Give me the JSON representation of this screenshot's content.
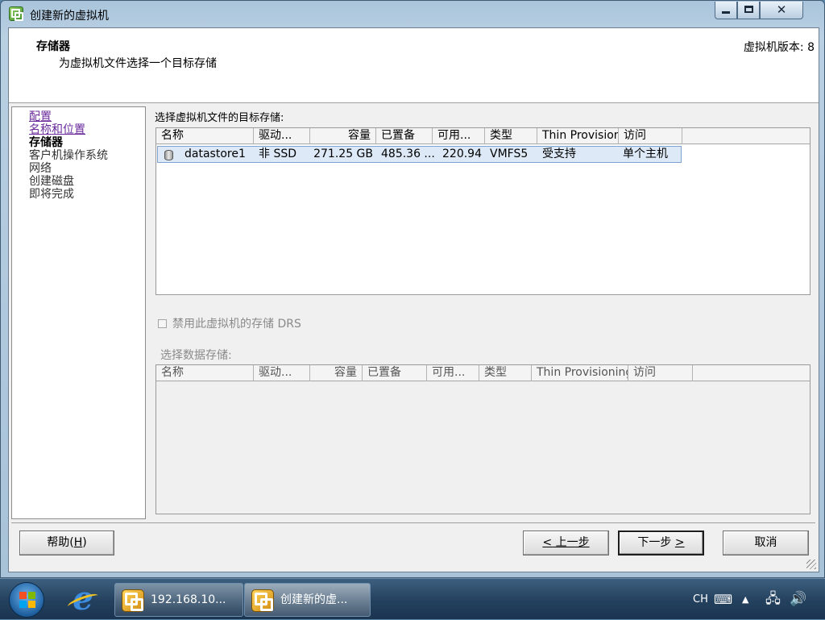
{
  "window": {
    "title": "创建新的虚拟机",
    "controls": {
      "minimize": "minimize-icon",
      "maximize": "maximize-icon",
      "close": "close-icon"
    }
  },
  "header": {
    "title": "存储器",
    "subtitle": "为虚拟机文件选择一个目标存储",
    "version": "虚拟机版本: 8"
  },
  "nav": {
    "items": [
      {
        "label": "配置",
        "state": "visited"
      },
      {
        "label": "名称和位置",
        "state": "visited"
      },
      {
        "label": "存储器",
        "state": "current"
      },
      {
        "label": "客户机操作系统",
        "state": "pending"
      },
      {
        "label": "网络",
        "state": "pending"
      },
      {
        "label": "创建磁盘",
        "state": "pending"
      },
      {
        "label": "即将完成",
        "state": "pending"
      }
    ]
  },
  "target_storage": {
    "label": "选择虚拟机文件的目标存储:",
    "columns": [
      "名称",
      "驱动...",
      "容量",
      "已置备",
      "可用...",
      "类型",
      "Thin Provision...",
      "访问"
    ],
    "rows": [
      {
        "icon": "datastore-icon",
        "name": "datastore1",
        "drive": "非 SSD",
        "capacity": "271.25 GB",
        "provisioned": "485.36 ...",
        "free": "220.94",
        "type": "VMFS5",
        "thin": "受支持",
        "access": "单个主机"
      }
    ]
  },
  "drs": {
    "label": "禁用此虚拟机的存储 DRS",
    "checked": false,
    "enabled": false
  },
  "select_datastore": {
    "label": "选择数据存储:",
    "columns": [
      "名称",
      "驱动...",
      "容量",
      "已置备",
      "可用...",
      "类型",
      "Thin Provisioning",
      "访问"
    ]
  },
  "buttons": {
    "help": "帮助(",
    "help_key": "H",
    "help_end": ")",
    "back_key": "<",
    "back": " 上一步",
    "next": "下一步 ",
    "next_key": ">",
    "cancel": "取消"
  },
  "taskbar": {
    "tasks": [
      {
        "label": "192.168.10...",
        "icon": "vsphere-client-icon"
      },
      {
        "label": "创建新的虚...",
        "icon": "vsphere-client-icon"
      }
    ],
    "tray": {
      "language": "CH"
    }
  }
}
